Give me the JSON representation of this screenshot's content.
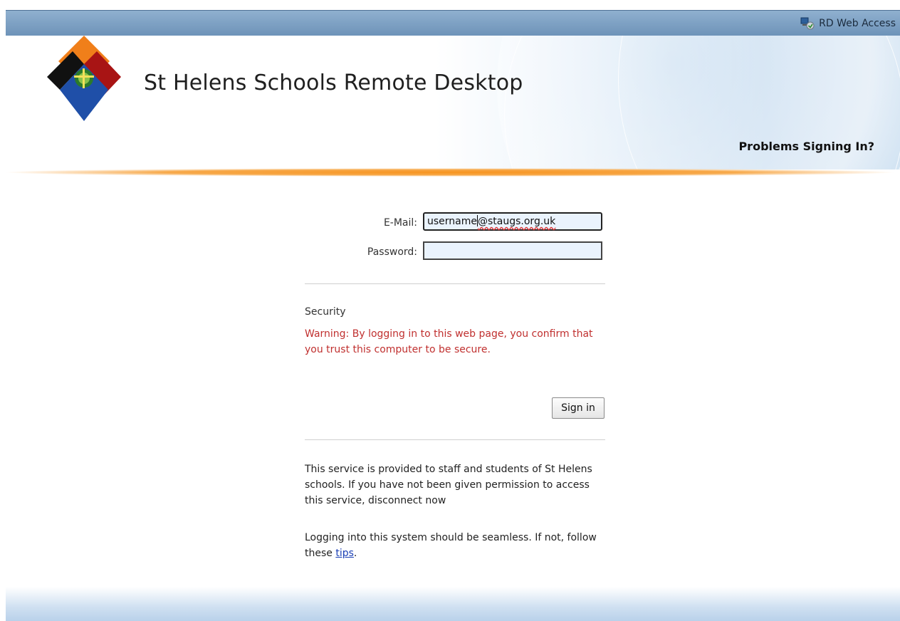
{
  "topbar": {
    "app_name": "RD Web Access",
    "app_icon": "rd-web-access-icon"
  },
  "header": {
    "logo": "puzzle-logo",
    "title": "St Helens Schools Remote Desktop",
    "help_link": "Problems Signing In?"
  },
  "form": {
    "email_label": "E-Mail:",
    "email_value_user": "username",
    "email_value_domain": "@staugs.org.uk",
    "password_label": "Password:",
    "password_value": "",
    "security_heading": "Security",
    "warning": "Warning: By logging in to this web page, you confirm that you trust this computer to be secure.",
    "signin_label": "Sign in"
  },
  "notice": {
    "service_text": "This service is provided to staff and students of St Helens schools. If you have not been given permission to access this service, disconnect now",
    "seamless_text": "Logging into this system should be seamless. If not, follow these",
    "tips_link": "tips",
    "tips_suffix": "."
  },
  "colors": {
    "warning": "#c0302f",
    "accent_orange": "#f7931e",
    "bar_blue": "#7a9cc0",
    "link": "#1a3fb5"
  }
}
